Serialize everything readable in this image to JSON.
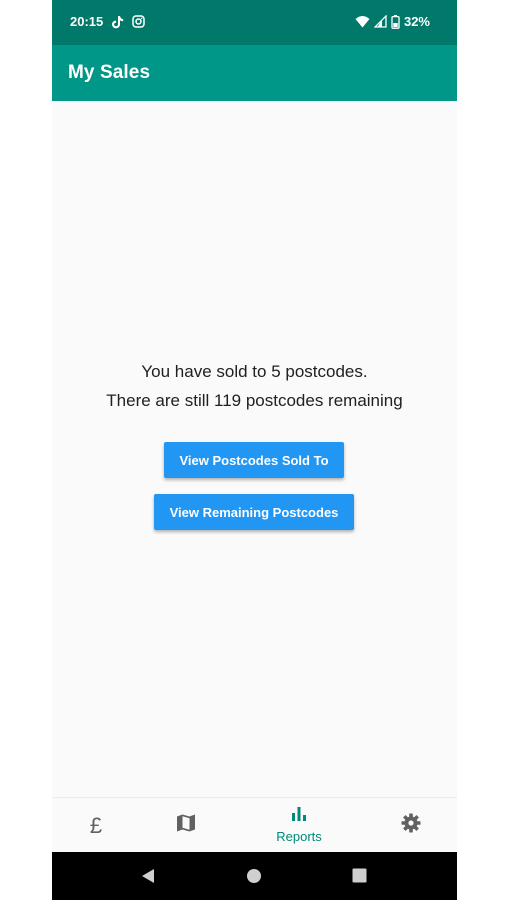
{
  "status_bar": {
    "time": "20:15",
    "battery": "32%",
    "icons": [
      "tiktok-icon",
      "instagram-icon",
      "wifi-icon",
      "signal-icon",
      "battery-icon"
    ]
  },
  "app_bar": {
    "title": "My Sales"
  },
  "main": {
    "sold_text": "You have sold to 5 postcodes.",
    "remaining_text": "There are still 119 postcodes remaining",
    "buttons": {
      "view_sold": "View Postcodes Sold To",
      "view_remaining": "View Remaining Postcodes"
    }
  },
  "bottom_nav": {
    "items": [
      {
        "id": "sales",
        "icon": "pound-sign-icon",
        "glyph": "£",
        "label": "",
        "active": false
      },
      {
        "id": "map",
        "icon": "map-icon",
        "label": "",
        "active": false
      },
      {
        "id": "reports",
        "icon": "bar-chart-icon",
        "label": "Reports",
        "active": true
      },
      {
        "id": "settings",
        "icon": "gear-icon",
        "label": "",
        "active": false
      }
    ]
  },
  "system_nav": {
    "icons": [
      "back-icon",
      "home-icon",
      "recents-icon"
    ]
  },
  "colors": {
    "status_bar": "#00796b",
    "app_bar": "#009688",
    "button": "#2196f3",
    "active_nav": "#00897b",
    "inactive_nav": "#616161",
    "background": "#fafafa"
  }
}
